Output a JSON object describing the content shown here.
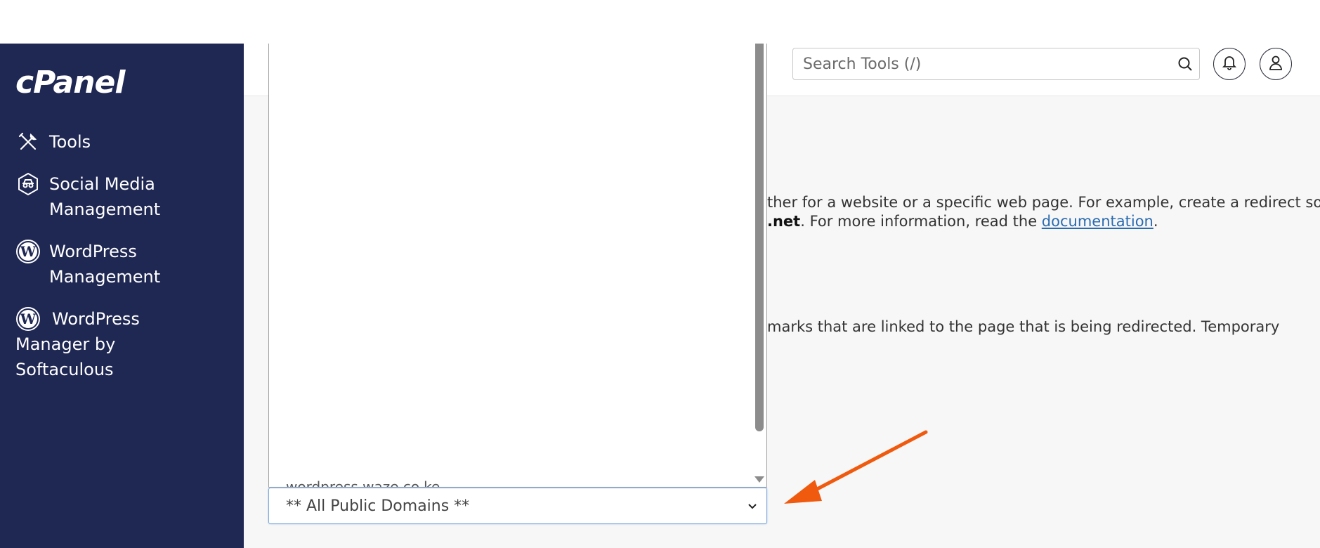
{
  "app": {
    "logo_text": "cPanel"
  },
  "sidebar": {
    "items": [
      {
        "label": "Tools",
        "icon": "tools-icon"
      },
      {
        "label": "Social Media\nManagement",
        "icon": "social-media-icon"
      },
      {
        "label": "WordPress\nManagement",
        "icon": "wordpress-icon"
      },
      {
        "label": "WordPress\nManager by\nSoftaculous",
        "icon": "wordpress-icon"
      }
    ]
  },
  "header": {
    "search_placeholder": "Search Tools (/)",
    "notifications_icon": "bell-icon",
    "user_icon": "user-icon"
  },
  "content": {
    "line1": "ther for a website or a specific web page. For example, create a redirect so",
    "line2_bold": ".net",
    "line2_text": ". For more information, read the ",
    "line2_link": "documentation",
    "line2_end": ".",
    "line3": "marks that are linked to the page that is being redirected. Temporary"
  },
  "dropdown": {
    "partial_item": "wordpress.waze.co.ke",
    "selected_value": "** All Public Domains **"
  },
  "annotation": {
    "arrow_color": "#f05a0e"
  },
  "colors": {
    "sidebar_bg": "#1f2753",
    "link": "#2b6cb0",
    "select_focus": "#7fa7d9"
  }
}
